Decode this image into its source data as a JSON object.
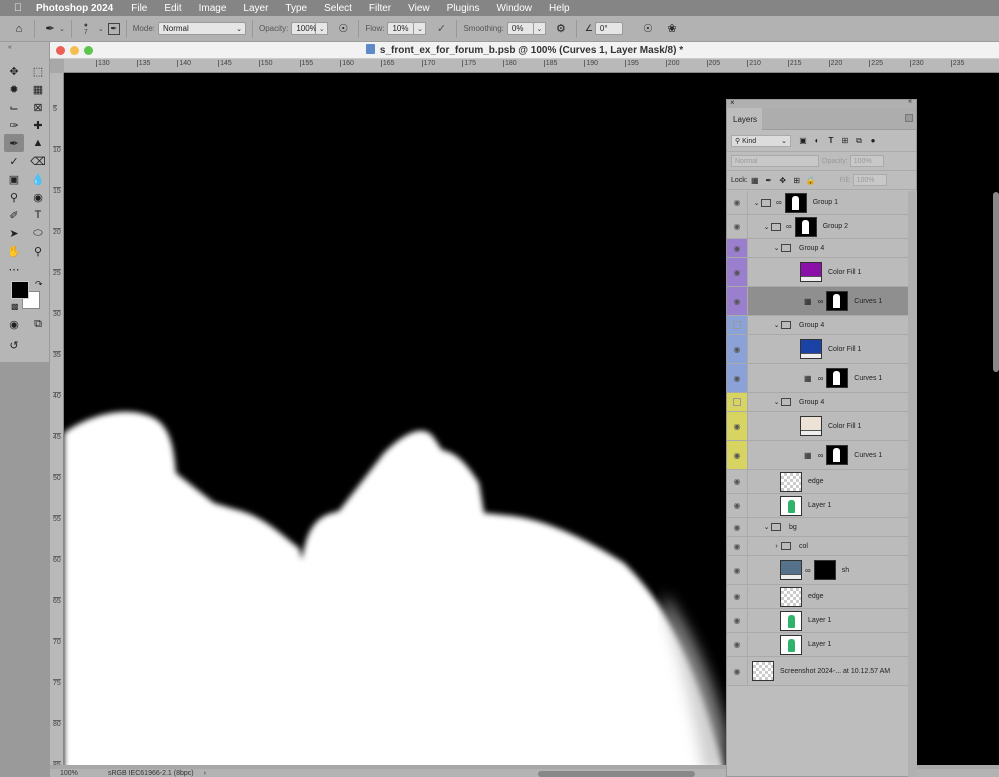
{
  "menubar": {
    "apple": "",
    "app_name": "Photoshop 2024",
    "items": [
      "File",
      "Edit",
      "Image",
      "Layer",
      "Type",
      "Select",
      "Filter",
      "View",
      "Plugins",
      "Window",
      "Help"
    ]
  },
  "options_bar": {
    "brush_size": "7",
    "mode_label": "Mode:",
    "mode_value": "Normal",
    "opacity_label": "Opacity:",
    "opacity_value": "100%",
    "flow_label": "Flow:",
    "flow_value": "10%",
    "smoothing_label": "Smoothing:",
    "smoothing_value": "0%",
    "angle_value": "0°"
  },
  "document": {
    "title": "s_front_ex_for_forum_b.psb @ 100% (Curves 1, Layer Mask/8) *",
    "h_ruler_ticks": [
      "130",
      "135",
      "140",
      "145",
      "150",
      "155",
      "160",
      "165",
      "170",
      "175",
      "180",
      "185",
      "190",
      "195",
      "200",
      "205",
      "210",
      "215",
      "220",
      "225",
      "230",
      "235"
    ],
    "v_ruler_ticks": [
      "5",
      "10",
      "15",
      "20",
      "25",
      "30",
      "35",
      "40",
      "45",
      "50",
      "55",
      "60",
      "65",
      "70",
      "75",
      "80",
      "85"
    ],
    "zoom": "100%",
    "color_profile": "sRGB IEC61966-2.1 (8bpc)"
  },
  "colors": {
    "purple_label": "#9b7fcf",
    "blue_label": "#8ba2d8",
    "yellow_label": "#d8d461",
    "fill_purple": "#8a10a8",
    "fill_blue": "#1b43a6",
    "fill_cream": "#ece3d6",
    "sh_fill": "#56728a"
  },
  "layers_panel": {
    "tab": "Layers",
    "filter_kind": "Kind",
    "blend_mode": "Normal",
    "opacity_label": "Opacity:",
    "opacity_value": "100%",
    "lock_label": "Lock:",
    "fill_label": "Fill:",
    "fill_value": "100%",
    "layers": [
      {
        "name": "Group 1",
        "type": "group-mask",
        "indent": 0,
        "label": "none",
        "visible": true,
        "expanded": true
      },
      {
        "name": "Group 2",
        "type": "group-mask",
        "indent": 1,
        "label": "none",
        "visible": true,
        "expanded": true
      },
      {
        "name": "Group 4",
        "type": "group",
        "indent": 2,
        "label": "purple",
        "visible": true,
        "expanded": true
      },
      {
        "name": "Color Fill 1",
        "type": "fill",
        "indent": 3,
        "label": "purple",
        "visible": true,
        "color": "#8a10a8"
      },
      {
        "name": "Curves 1",
        "type": "curves",
        "indent": 3,
        "label": "purple",
        "visible": true,
        "selected": true
      },
      {
        "name": "Group 4",
        "type": "group",
        "indent": 2,
        "label": "blue",
        "visible": false,
        "expanded": true
      },
      {
        "name": "Color Fill 1",
        "type": "fill",
        "indent": 3,
        "label": "blue",
        "visible": true,
        "color": "#1b43a6"
      },
      {
        "name": "Curves 1",
        "type": "curves",
        "indent": 3,
        "label": "blue",
        "visible": true
      },
      {
        "name": "Group 4",
        "type": "group",
        "indent": 2,
        "label": "yellow",
        "visible": false,
        "expanded": true
      },
      {
        "name": "Color Fill 1",
        "type": "fill",
        "indent": 3,
        "label": "yellow",
        "visible": true,
        "color": "#ece3d6"
      },
      {
        "name": "Curves 1",
        "type": "curves",
        "indent": 3,
        "label": "yellow",
        "visible": true
      },
      {
        "name": "edge",
        "type": "pixel-transparent",
        "indent": 2,
        "label": "none",
        "visible": true
      },
      {
        "name": "Layer 1",
        "type": "pixel-person",
        "indent": 2,
        "label": "none",
        "visible": true
      },
      {
        "name": "bg",
        "type": "group",
        "indent": 1,
        "label": "none",
        "visible": true,
        "expanded": true
      },
      {
        "name": "col",
        "type": "group",
        "indent": 2,
        "label": "none",
        "visible": true,
        "expanded": false
      },
      {
        "name": "sh",
        "type": "fill-mask",
        "indent": 2,
        "label": "none",
        "visible": true,
        "color": "#56728a"
      },
      {
        "name": "edge",
        "type": "pixel-transparent",
        "indent": 2,
        "label": "none",
        "visible": true
      },
      {
        "name": "Layer 1",
        "type": "pixel-person",
        "indent": 2,
        "label": "none",
        "visible": true
      },
      {
        "name": "Layer 1",
        "type": "pixel-person",
        "indent": 2,
        "label": "none",
        "visible": true
      },
      {
        "name": "Screenshot 2024-... at 10.12.57 AM",
        "type": "smart",
        "indent": 0,
        "label": "none",
        "visible": true
      }
    ]
  }
}
